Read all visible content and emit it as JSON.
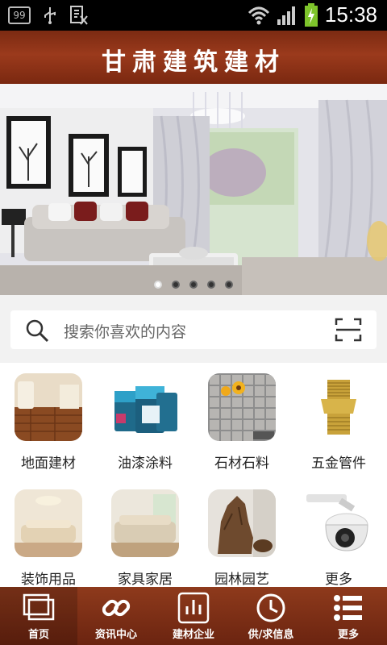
{
  "status_bar": {
    "badge": "99",
    "time": "15:38",
    "icons": [
      "notification-count-icon",
      "usb-icon",
      "document-icon",
      "wifi-icon",
      "signal-icon",
      "battery-charging-icon"
    ]
  },
  "header": {
    "title": "甘肃建筑建材"
  },
  "banner": {
    "slides": 5,
    "active_slide": 1
  },
  "search": {
    "placeholder": "搜索你喜欢的内容"
  },
  "categories": [
    {
      "label": "地面建材",
      "icon": "flooring-image"
    },
    {
      "label": "油漆涂料",
      "icon": "paint-cans-image"
    },
    {
      "label": "石材石料",
      "icon": "stone-tiles-image"
    },
    {
      "label": "五金管件",
      "icon": "brass-fitting-image"
    },
    {
      "label": "装饰用品",
      "icon": "decor-room-image"
    },
    {
      "label": "家具家居",
      "icon": "sofa-room-image"
    },
    {
      "label": "园林园艺",
      "icon": "garden-rock-image"
    },
    {
      "label": "更多",
      "icon": "camera-dome-image"
    }
  ],
  "tabs": [
    {
      "label": "首页",
      "icon": "home-icon",
      "active": true
    },
    {
      "label": "资讯中心",
      "icon": "link-icon",
      "active": false
    },
    {
      "label": "建材企业",
      "icon": "chart-icon",
      "active": false
    },
    {
      "label": "供/求信息",
      "icon": "clock-icon",
      "active": false
    },
    {
      "label": "更多",
      "icon": "list-icon",
      "active": false
    }
  ]
}
